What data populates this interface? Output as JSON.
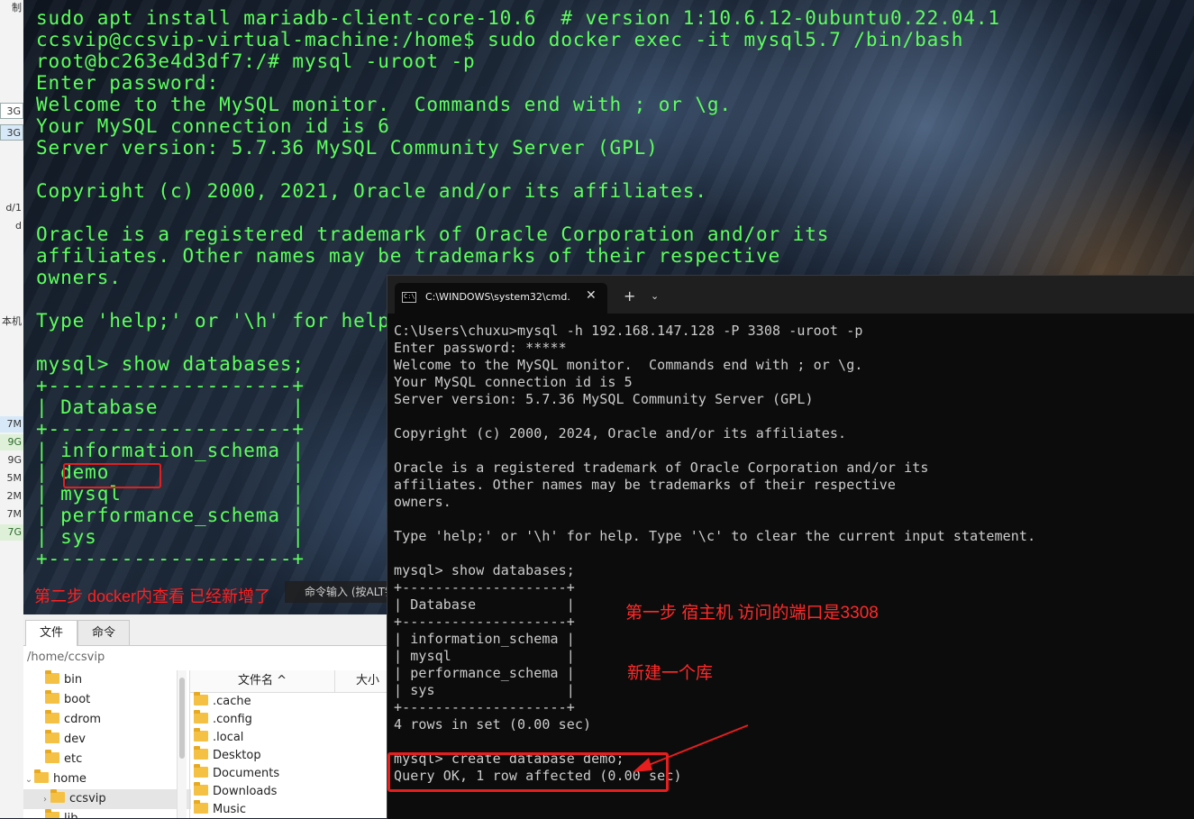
{
  "left_strip": {
    "fragments": [
      "制",
      "3G",
      "3G",
      "d/1",
      "d",
      "本机",
      "7M",
      "9G",
      "9G",
      "5M",
      "2M",
      "7M",
      "7G"
    ]
  },
  "bg_terminal": {
    "lines": [
      "sudo apt install mariadb-client-core-10.6  # version 1:10.6.12-0ubuntu0.22.04.1",
      "ccsvip@ccsvip-virtual-machine:/home$ sudo docker exec -it mysql5.7 /bin/bash",
      "root@bc263e4d3df7:/# mysql -uroot -p",
      "Enter password:",
      "Welcome to the MySQL monitor.  Commands end with ; or \\g.",
      "Your MySQL connection id is 6",
      "Server version: 5.7.36 MySQL Community Server (GPL)",
      "",
      "Copyright (c) 2000, 2021, Oracle and/or its affiliates.",
      "",
      "Oracle is a registered trademark of Oracle Corporation and/or its",
      "affiliates. Other names may be trademarks of their respective",
      "owners.",
      "",
      "Type 'help;' or '\\h' for help.",
      "",
      "mysql> show databases;",
      "+--------------------+",
      "| Database           |",
      "+--------------------+",
      "| information_schema |",
      "| demo               |",
      "| mysql              |",
      "| performance_schema |",
      "| sys                |",
      "+--------------------+"
    ],
    "annotation": "第二步 docker内查看 已经新增了",
    "tooltip": "命令输入 (按ALT键提"
  },
  "file_manager": {
    "tabs": [
      "文件",
      "命令"
    ],
    "path": "/home/ccsvip",
    "tree": [
      {
        "name": "bin",
        "arrow": ""
      },
      {
        "name": "boot",
        "arrow": ""
      },
      {
        "name": "cdrom",
        "arrow": ""
      },
      {
        "name": "dev",
        "arrow": ""
      },
      {
        "name": "etc",
        "arrow": ""
      },
      {
        "name": "home",
        "arrow": "⌄"
      },
      {
        "name": "ccsvip",
        "arrow": "›"
      },
      {
        "name": "lib",
        "arrow": ""
      }
    ],
    "columns": {
      "name": "文件名 ^",
      "size": "大小"
    },
    "files": [
      ".cache",
      ".config",
      ".local",
      "Desktop",
      "Documents",
      "Downloads",
      "Music"
    ]
  },
  "cmd_window": {
    "tab_title": "C:\\WINDOWS\\system32\\cmd.",
    "close": "✕",
    "new_tab": "+",
    "dropdown": "⌄",
    "lines": [
      "C:\\Users\\chuxu>mysql -h 192.168.147.128 -P 3308 -uroot -p",
      "Enter password: *****",
      "Welcome to the MySQL monitor.  Commands end with ; or \\g.",
      "Your MySQL connection id is 5",
      "Server version: 5.7.36 MySQL Community Server (GPL)",
      "",
      "Copyright (c) 2000, 2024, Oracle and/or its affiliates.",
      "",
      "Oracle is a registered trademark of Oracle Corporation and/or its",
      "affiliates. Other names may be trademarks of their respective",
      "owners.",
      "",
      "Type 'help;' or '\\h' for help. Type '\\c' to clear the current input statement.",
      "",
      "mysql> show databases;",
      "+--------------------+",
      "| Database           |",
      "+--------------------+",
      "| information_schema |",
      "| mysql              |",
      "| performance_schema |",
      "| sys                |",
      "+--------------------+",
      "4 rows in set (0.00 sec)",
      "",
      "mysql> create database demo;",
      "Query OK, 1 row affected (0.00 sec)"
    ],
    "annotation_step1": "第一步 宿主机 访问的端口是3308",
    "annotation_newdb": "新建一个库"
  }
}
